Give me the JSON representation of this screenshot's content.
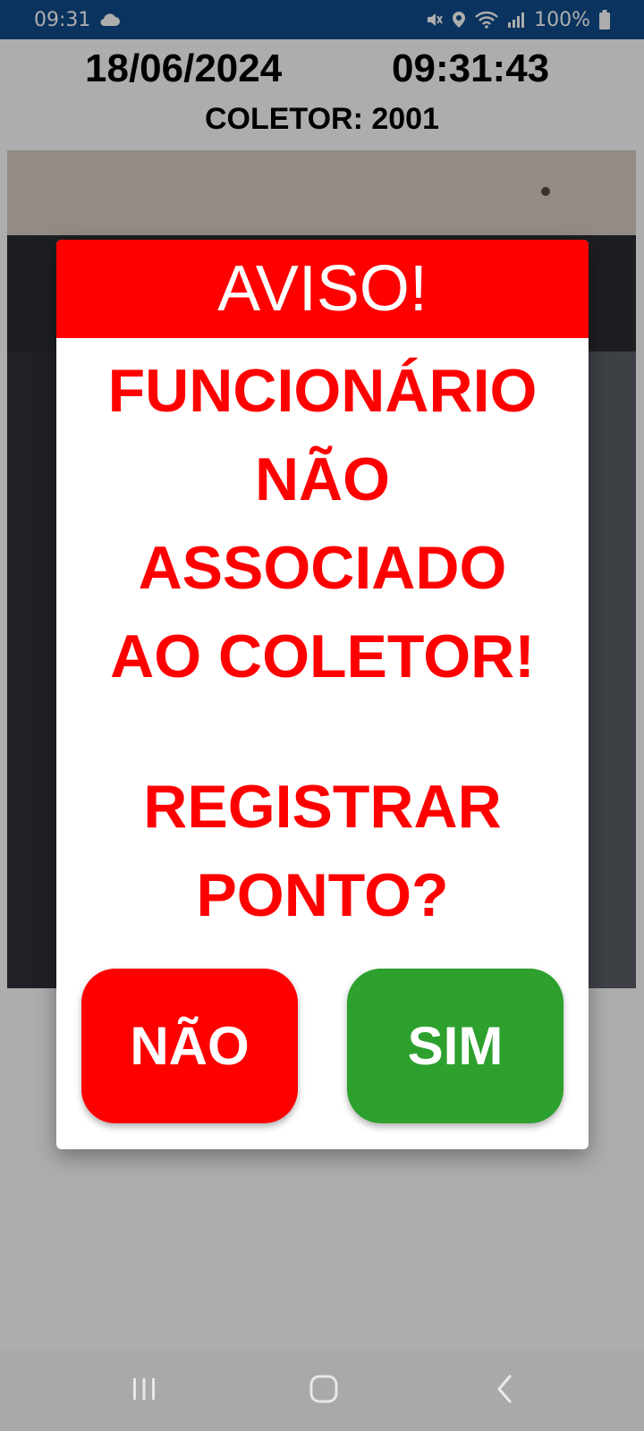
{
  "status_bar": {
    "time": "09:31",
    "battery": "100%",
    "icons": [
      "cloud-icon",
      "mute-icon",
      "location-icon",
      "wifi-icon",
      "signal-icon",
      "battery-icon"
    ]
  },
  "header": {
    "date": "18/06/2024",
    "time": "09:31:43",
    "collector": "COLETOR: 2001"
  },
  "dialog": {
    "title": "AVISO!",
    "message_lines": [
      "FUNCIONÁRIO",
      "NÃO",
      "ASSOCIADO",
      "AO COLETOR!"
    ],
    "question_lines": [
      "REGISTRAR",
      "PONTO?"
    ],
    "no_label": "NÃO",
    "yes_label": "SIM"
  },
  "colors": {
    "status_bar": "#0f4c8c",
    "dialog_title_bg": "#ff0000",
    "message_text": "#ff0000",
    "no_button": "#ff0000",
    "yes_button": "#2da02d",
    "nav_bar": "#a9a9a9"
  },
  "nav_bar": {
    "icons": [
      "recents-icon",
      "home-icon",
      "back-icon"
    ]
  }
}
